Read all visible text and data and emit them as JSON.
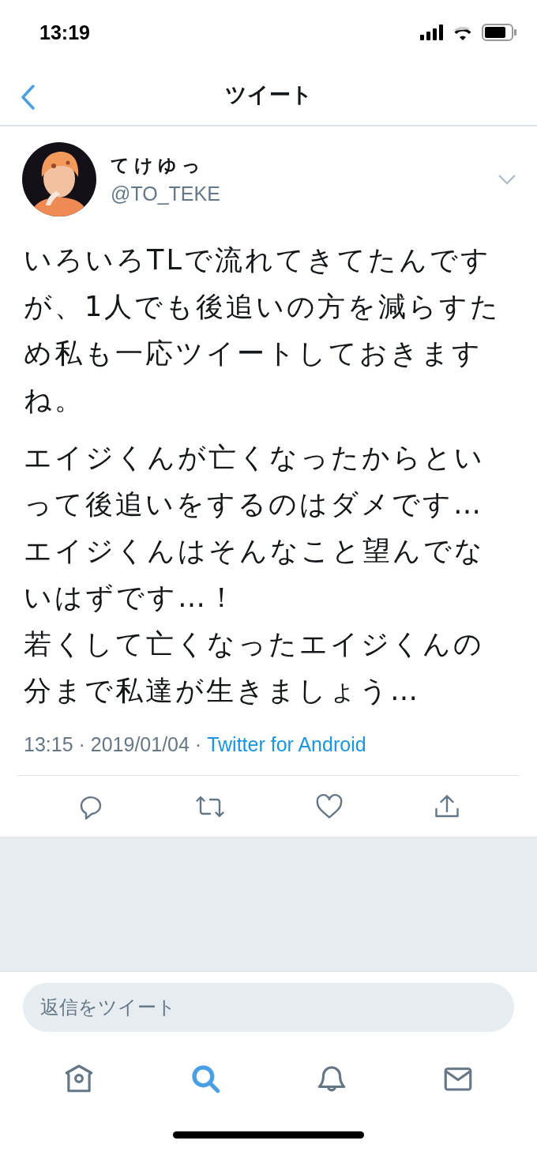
{
  "status_bar": {
    "time": "13:19"
  },
  "nav": {
    "title": "ツイート"
  },
  "tweet": {
    "author": {
      "name": "てけゆっ",
      "handle": "@TO_TEKE"
    },
    "paragraphs": [
      [
        "いろいろTLで流れてきてたんですが、1人でも後追いの方を減らすため私も一応ツイートしておきますね。"
      ],
      [
        "エイジくんが亡くなったからといって後追いをするのはダメです…",
        "エイジくんはそんなこと望んでないはずです…！",
        "若くして亡くなったエイジくんの分まで私達が生きましょう…"
      ]
    ],
    "time": "13:15 · 2019/01/04 · ",
    "source": "Twitter for Android"
  },
  "actions": [
    {
      "kind": "reply"
    },
    {
      "kind": "retweet"
    },
    {
      "kind": "like"
    },
    {
      "kind": "share"
    }
  ],
  "reply_field": {
    "placeholder": "返信をツイート"
  },
  "tab_bar": [
    {
      "kind": "home",
      "selected": false
    },
    {
      "kind": "search",
      "selected": true
    },
    {
      "kind": "notifications",
      "selected": false
    },
    {
      "kind": "messages",
      "selected": false
    }
  ]
}
